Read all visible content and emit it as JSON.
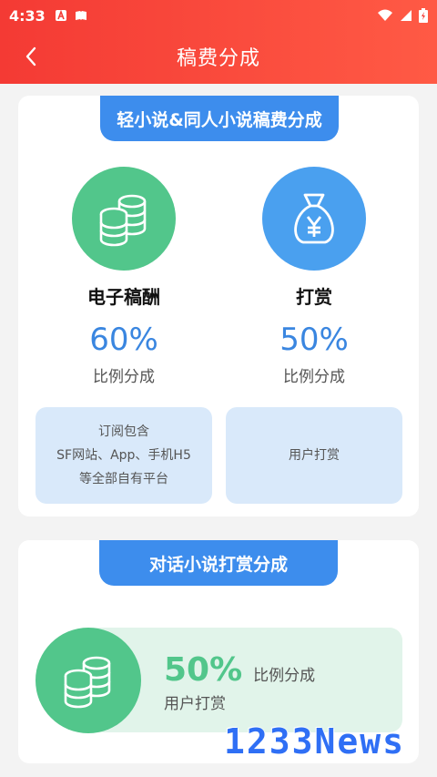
{
  "status": {
    "time": "4:33"
  },
  "nav": {
    "title": "稿费分成",
    "back_icon": "back-arrow-icon"
  },
  "section1": {
    "header": "轻小说&同人小说稿费分成",
    "items": [
      {
        "name": "电子稿酬",
        "percent": "60%",
        "label": "比例分成",
        "icon": "coins-icon",
        "color": "#52c68b"
      },
      {
        "name": "打赏",
        "percent": "50%",
        "label": "比例分成",
        "icon": "money-bag-icon",
        "color": "#4aa0ef"
      }
    ],
    "boxes": [
      {
        "lines": [
          "订阅包含",
          "SF网站、App、手机H5",
          "等全部自有平台"
        ]
      },
      {
        "lines": [
          "用户打赏"
        ]
      }
    ]
  },
  "section2": {
    "header": "对话小说打赏分成",
    "percent": "50%",
    "label": "比例分成",
    "sub": "用户打赏",
    "icon": "coins-icon"
  },
  "watermark": "1233News",
  "colors": {
    "topbar": "#f43a34",
    "accent_blue": "#3d8ded",
    "accent_green": "#52c68b"
  }
}
